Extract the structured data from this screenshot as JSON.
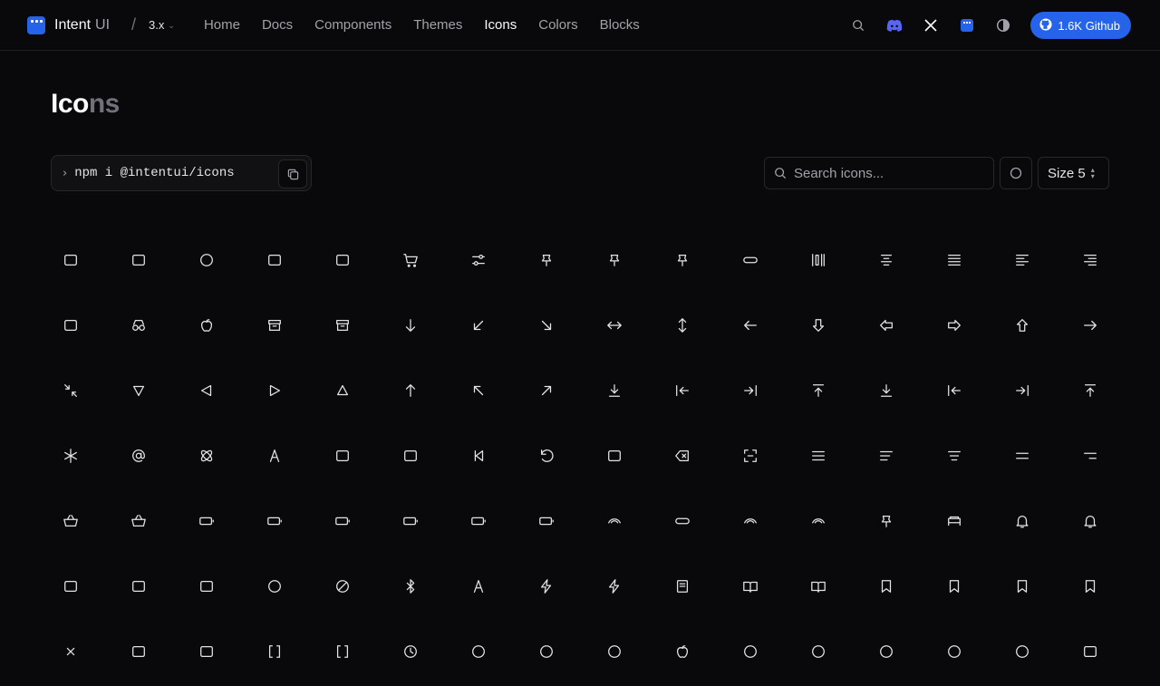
{
  "header": {
    "brand_name": "Intent",
    "brand_suffix": "UI",
    "version": "3.x",
    "nav": [
      {
        "label": "Home",
        "active": false
      },
      {
        "label": "Docs",
        "active": false
      },
      {
        "label": "Components",
        "active": false
      },
      {
        "label": "Themes",
        "active": false
      },
      {
        "label": "Icons",
        "active": true
      },
      {
        "label": "Colors",
        "active": false
      },
      {
        "label": "Blocks",
        "active": false
      }
    ],
    "tools": [
      "search-icon",
      "discord-icon",
      "x-logo-icon",
      "intentui-logo-icon",
      "theme-toggle-icon"
    ],
    "github_label": "1.6K Github",
    "accent": "#2563eb"
  },
  "page": {
    "title_a": "Ico",
    "title_b": "ns",
    "install_command": "npm i @intentui/icons",
    "search_placeholder": "Search icons...",
    "size_label": "Size 5"
  },
  "icons": [
    "4k-icon",
    "academic-cap-icon",
    "accessibility-icon",
    "photo-card-icon",
    "adapter-icon",
    "cart-add-icon",
    "adjustments-icon",
    "pin-icon",
    "pin-alt-icon",
    "airpods-icon",
    "airpods-case-icon",
    "align-vertical-icon",
    "align-center-icon",
    "align-justify-icon",
    "align-left-icon",
    "align-right-icon",
    "alt-icon",
    "glasses-icon",
    "apple-icon",
    "archive-icon",
    "archive-box-icon",
    "arrow-down-icon",
    "arrow-down-left-icon",
    "arrow-down-right-icon",
    "arrows-horizontal-icon",
    "arrows-vertical-icon",
    "arrow-left-icon",
    "arrow-down-wide-icon",
    "arrow-left-wide-icon",
    "arrow-right-wide-icon",
    "arrow-up-wide-icon",
    "arrow-right-icon",
    "collapse-icon",
    "triangle-down-icon",
    "triangle-left-icon",
    "triangle-right-icon",
    "triangle-up-icon",
    "arrow-up-icon",
    "arrow-up-left-icon",
    "arrow-up-right-icon",
    "arrow-to-bottom-icon",
    "arrow-to-left-icon",
    "arrow-to-right-icon",
    "arrow-to-top-icon",
    "arrow-down-to-line-icon",
    "arrow-left-to-line-icon",
    "arrow-right-to-line-icon",
    "arrow-up-to-line-icon",
    "asterisk-icon",
    "at-sign-icon",
    "atom-icon",
    "text-a-icon",
    "vr-headset-icon",
    "avocado-icon",
    "skip-back-icon",
    "rewind-10-icon",
    "backpack-icon",
    "backspace-icon",
    "scan-icon",
    "bars-icon",
    "bars-left-icon",
    "bars-center-icon",
    "bars-equal-icon",
    "bars-right-icon",
    "basket-icon",
    "basket-plus-icon",
    "battery-empty-icon",
    "battery-x-icon",
    "battery-full-icon",
    "battery-charging-icon",
    "battery-low-icon",
    "battery-half-icon",
    "beats-icon",
    "pill-icon",
    "beats-fit-icon",
    "beats-solo-icon",
    "earbuds-icon",
    "bed-icon",
    "bell-icon",
    "bell-ring-icon",
    "bezier-icon",
    "bill-icon",
    "birthday-cake-icon",
    "bitcoin-icon",
    "block-icon",
    "bluetooth-icon",
    "bold-icon",
    "bolt-icon",
    "bolt-slash-icon",
    "book-icon",
    "book-open-icon",
    "book-reader-icon",
    "bookmark-icon",
    "bookmark-x-icon",
    "bookmark-fold-icon",
    "bookmark-plus-icon",
    "box-x-icon",
    "briefcase-icon",
    "beaker-icon",
    "bracket-icon",
    "bracket-alt-icon",
    "clock-icon",
    "brand-a-icon",
    "brand-b-icon",
    "brand-c-icon",
    "apple-logo-icon",
    "brand-d-icon",
    "brand-e-icon",
    "brand-f-icon",
    "brand-g-icon",
    "brand-h-icon",
    "aws-icon"
  ]
}
